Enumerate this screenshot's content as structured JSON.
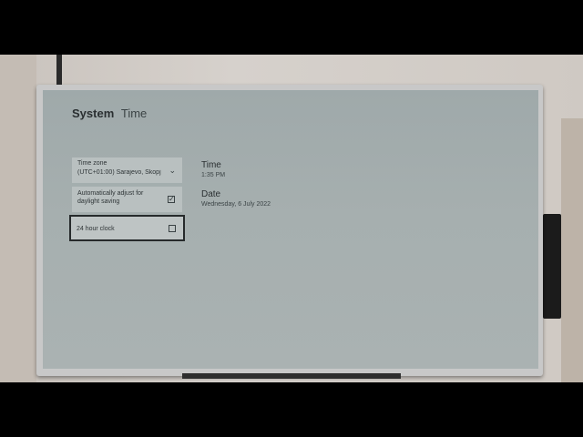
{
  "page": {
    "title_bold": "System",
    "title_light": "Time"
  },
  "settings": {
    "time_zone": {
      "label": "Time zone",
      "value": "(UTC+01:00) Sarajevo, Skopj..."
    },
    "daylight_saving": {
      "label": "Automatically adjust for daylight saving",
      "checked": true
    },
    "clock_24h": {
      "label": "24 hour clock",
      "checked": false,
      "focused": true
    }
  },
  "info": {
    "time_heading": "Time",
    "time_value": "1:35 PM",
    "date_heading": "Date",
    "date_value": "Wednesday, 6 July 2022"
  },
  "icons": {
    "dropdown": "chevron-down-icon",
    "checked": "checkbox-checked-icon",
    "unchecked": "checkbox-empty-icon"
  },
  "colors": {
    "screen_bg": "#a6afaf",
    "setting_bg": "#b9c0c0",
    "focus_border": "#262a2b",
    "text": "#2a2f31"
  }
}
